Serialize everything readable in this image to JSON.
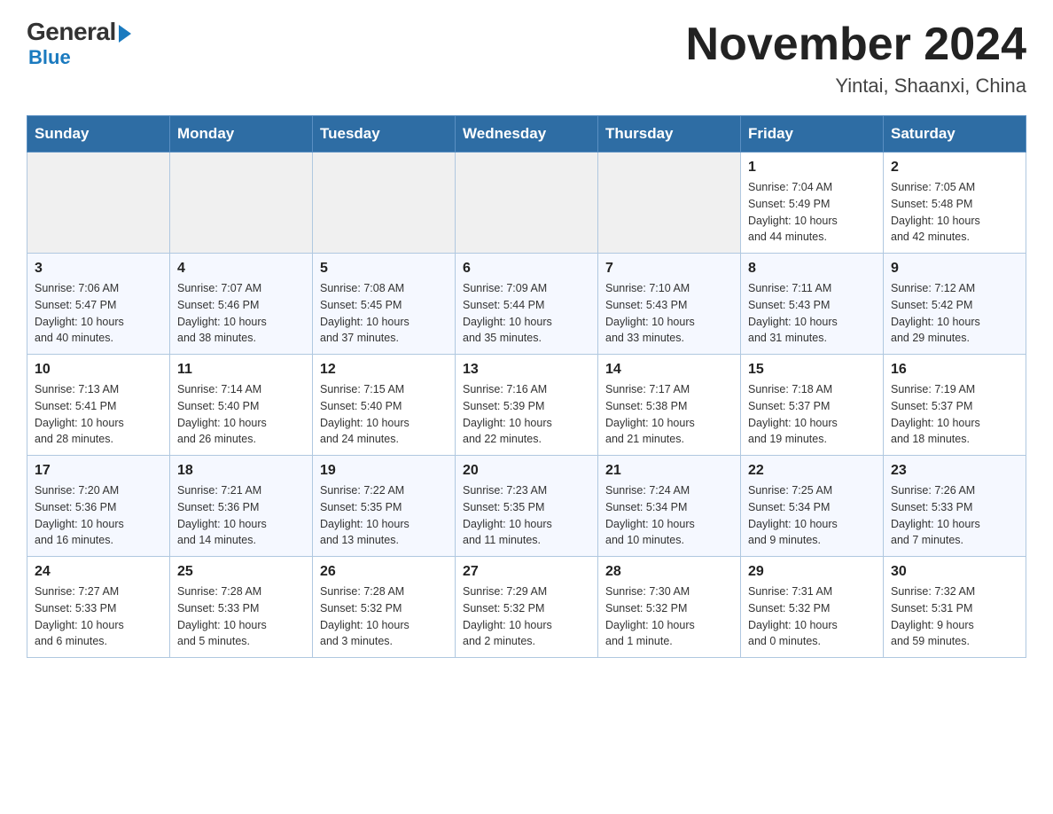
{
  "header": {
    "logo_general": "General",
    "logo_blue": "Blue",
    "month_title": "November 2024",
    "location": "Yintai, Shaanxi, China"
  },
  "weekdays": [
    "Sunday",
    "Monday",
    "Tuesday",
    "Wednesday",
    "Thursday",
    "Friday",
    "Saturday"
  ],
  "weeks": [
    [
      {
        "day": "",
        "info": ""
      },
      {
        "day": "",
        "info": ""
      },
      {
        "day": "",
        "info": ""
      },
      {
        "day": "",
        "info": ""
      },
      {
        "day": "",
        "info": ""
      },
      {
        "day": "1",
        "info": "Sunrise: 7:04 AM\nSunset: 5:49 PM\nDaylight: 10 hours\nand 44 minutes."
      },
      {
        "day": "2",
        "info": "Sunrise: 7:05 AM\nSunset: 5:48 PM\nDaylight: 10 hours\nand 42 minutes."
      }
    ],
    [
      {
        "day": "3",
        "info": "Sunrise: 7:06 AM\nSunset: 5:47 PM\nDaylight: 10 hours\nand 40 minutes."
      },
      {
        "day": "4",
        "info": "Sunrise: 7:07 AM\nSunset: 5:46 PM\nDaylight: 10 hours\nand 38 minutes."
      },
      {
        "day": "5",
        "info": "Sunrise: 7:08 AM\nSunset: 5:45 PM\nDaylight: 10 hours\nand 37 minutes."
      },
      {
        "day": "6",
        "info": "Sunrise: 7:09 AM\nSunset: 5:44 PM\nDaylight: 10 hours\nand 35 minutes."
      },
      {
        "day": "7",
        "info": "Sunrise: 7:10 AM\nSunset: 5:43 PM\nDaylight: 10 hours\nand 33 minutes."
      },
      {
        "day": "8",
        "info": "Sunrise: 7:11 AM\nSunset: 5:43 PM\nDaylight: 10 hours\nand 31 minutes."
      },
      {
        "day": "9",
        "info": "Sunrise: 7:12 AM\nSunset: 5:42 PM\nDaylight: 10 hours\nand 29 minutes."
      }
    ],
    [
      {
        "day": "10",
        "info": "Sunrise: 7:13 AM\nSunset: 5:41 PM\nDaylight: 10 hours\nand 28 minutes."
      },
      {
        "day": "11",
        "info": "Sunrise: 7:14 AM\nSunset: 5:40 PM\nDaylight: 10 hours\nand 26 minutes."
      },
      {
        "day": "12",
        "info": "Sunrise: 7:15 AM\nSunset: 5:40 PM\nDaylight: 10 hours\nand 24 minutes."
      },
      {
        "day": "13",
        "info": "Sunrise: 7:16 AM\nSunset: 5:39 PM\nDaylight: 10 hours\nand 22 minutes."
      },
      {
        "day": "14",
        "info": "Sunrise: 7:17 AM\nSunset: 5:38 PM\nDaylight: 10 hours\nand 21 minutes."
      },
      {
        "day": "15",
        "info": "Sunrise: 7:18 AM\nSunset: 5:37 PM\nDaylight: 10 hours\nand 19 minutes."
      },
      {
        "day": "16",
        "info": "Sunrise: 7:19 AM\nSunset: 5:37 PM\nDaylight: 10 hours\nand 18 minutes."
      }
    ],
    [
      {
        "day": "17",
        "info": "Sunrise: 7:20 AM\nSunset: 5:36 PM\nDaylight: 10 hours\nand 16 minutes."
      },
      {
        "day": "18",
        "info": "Sunrise: 7:21 AM\nSunset: 5:36 PM\nDaylight: 10 hours\nand 14 minutes."
      },
      {
        "day": "19",
        "info": "Sunrise: 7:22 AM\nSunset: 5:35 PM\nDaylight: 10 hours\nand 13 minutes."
      },
      {
        "day": "20",
        "info": "Sunrise: 7:23 AM\nSunset: 5:35 PM\nDaylight: 10 hours\nand 11 minutes."
      },
      {
        "day": "21",
        "info": "Sunrise: 7:24 AM\nSunset: 5:34 PM\nDaylight: 10 hours\nand 10 minutes."
      },
      {
        "day": "22",
        "info": "Sunrise: 7:25 AM\nSunset: 5:34 PM\nDaylight: 10 hours\nand 9 minutes."
      },
      {
        "day": "23",
        "info": "Sunrise: 7:26 AM\nSunset: 5:33 PM\nDaylight: 10 hours\nand 7 minutes."
      }
    ],
    [
      {
        "day": "24",
        "info": "Sunrise: 7:27 AM\nSunset: 5:33 PM\nDaylight: 10 hours\nand 6 minutes."
      },
      {
        "day": "25",
        "info": "Sunrise: 7:28 AM\nSunset: 5:33 PM\nDaylight: 10 hours\nand 5 minutes."
      },
      {
        "day": "26",
        "info": "Sunrise: 7:28 AM\nSunset: 5:32 PM\nDaylight: 10 hours\nand 3 minutes."
      },
      {
        "day": "27",
        "info": "Sunrise: 7:29 AM\nSunset: 5:32 PM\nDaylight: 10 hours\nand 2 minutes."
      },
      {
        "day": "28",
        "info": "Sunrise: 7:30 AM\nSunset: 5:32 PM\nDaylight: 10 hours\nand 1 minute."
      },
      {
        "day": "29",
        "info": "Sunrise: 7:31 AM\nSunset: 5:32 PM\nDaylight: 10 hours\nand 0 minutes."
      },
      {
        "day": "30",
        "info": "Sunrise: 7:32 AM\nSunset: 5:31 PM\nDaylight: 9 hours\nand 59 minutes."
      }
    ]
  ]
}
